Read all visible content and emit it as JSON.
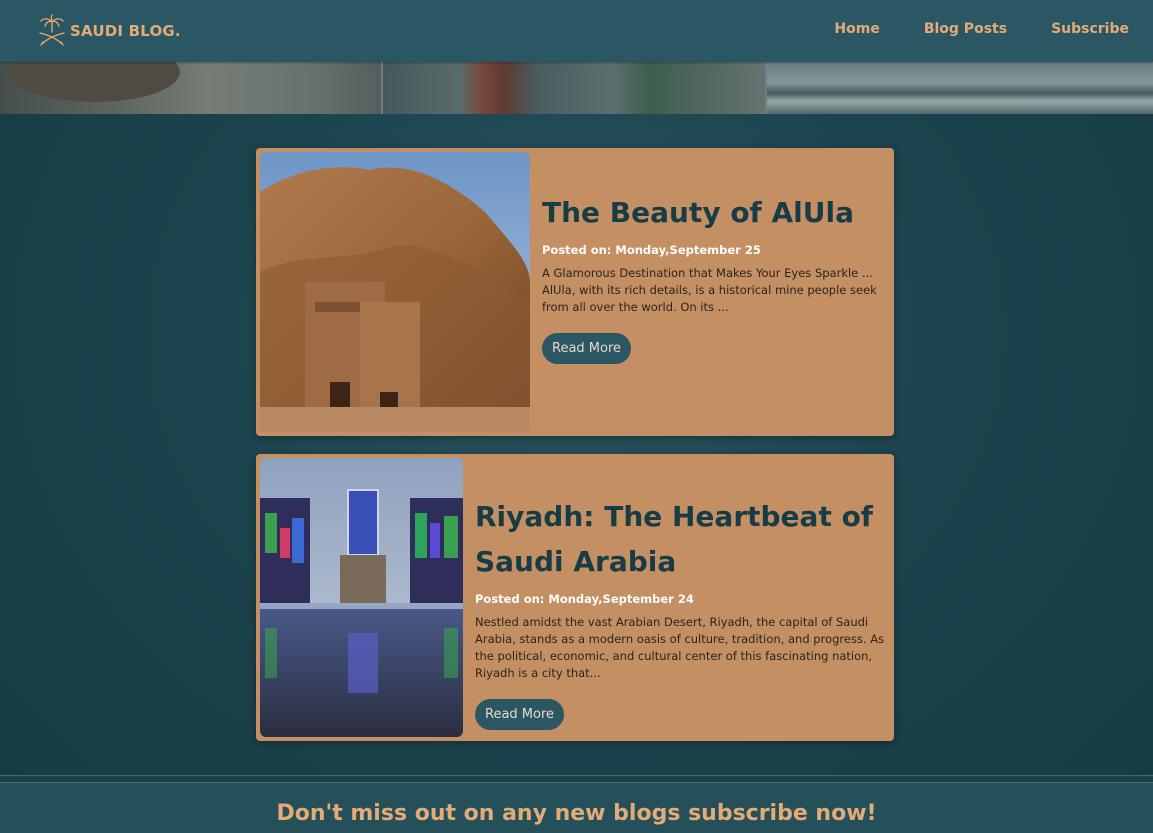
{
  "brand": {
    "name": "SAUDI BLOG.",
    "logo_icon": "palm-swords-icon",
    "accent": "#e3ab77"
  },
  "nav": {
    "items": [
      "Home",
      "Blog Posts",
      "Subscribe"
    ]
  },
  "colors": {
    "header": "#2b5663",
    "card": "#c48f62",
    "title": "#183c46",
    "button": "#2b5663",
    "background": "#1c444e"
  },
  "posts": [
    {
      "title": "The Beauty of AlUla",
      "date": "Posted on: Monday,September 25",
      "excerpt": "A Glamorous Destination that Makes Your Eyes Sparkle ... AlUla, with its rich details, is a historical mine people seek from all over the world. On its ...",
      "button": "Read More"
    },
    {
      "title": "Riyadh: The Heartbeat of Saudi Arabia",
      "date": "Posted on: Monday,September 24",
      "excerpt": "Nestled amidst the vast Arabian Desert, Riyadh, the capital of Saudi Arabia, stands as a modern oasis of culture, tradition, and progress. As the political, economic, and cultural center of this fascinating nation, Riyadh is a city that...",
      "button": "Read More"
    }
  ],
  "footer": {
    "cta": "Don't miss out on any new blogs subscribe now!"
  }
}
